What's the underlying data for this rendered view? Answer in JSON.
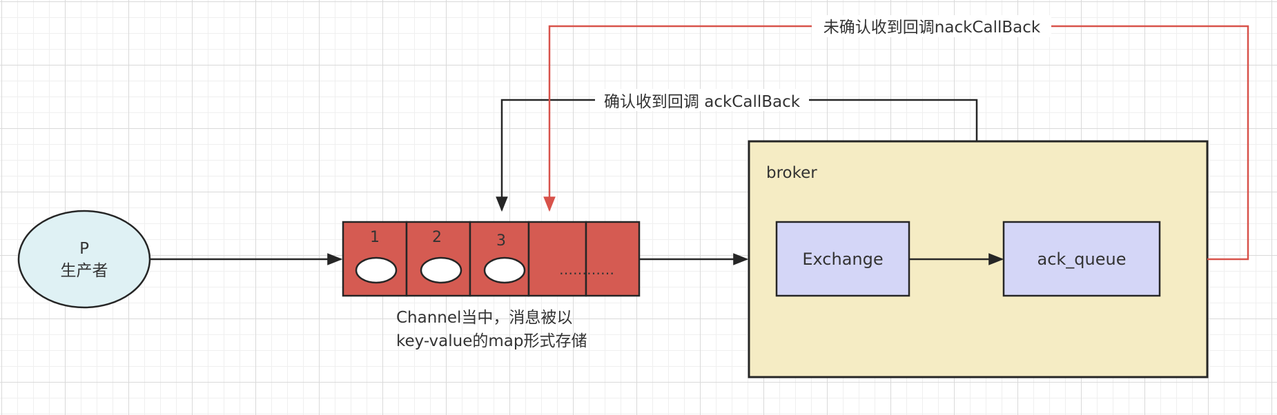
{
  "producer": {
    "symbol": "P",
    "label": "生产者"
  },
  "channel": {
    "slots": [
      "1",
      "2",
      "3"
    ],
    "ellipsis": "…………",
    "caption_line1": "Channel当中，消息被以",
    "caption_line2": "key-value的map形式存储"
  },
  "broker": {
    "label": "broker",
    "exchange_label": "Exchange",
    "queue_label": "ack_queue"
  },
  "callbacks": {
    "ack_label": "确认收到回调 ackCallBack",
    "nack_label": "未确认收到回调nackCallBack"
  },
  "colors": {
    "producer_fill": "#dff1f4",
    "channel_fill": "#d55b52",
    "broker_fill": "#f5ecc4",
    "node_fill": "#d4d6f7",
    "stroke": "#262626",
    "nack_line": "#d8524a"
  }
}
